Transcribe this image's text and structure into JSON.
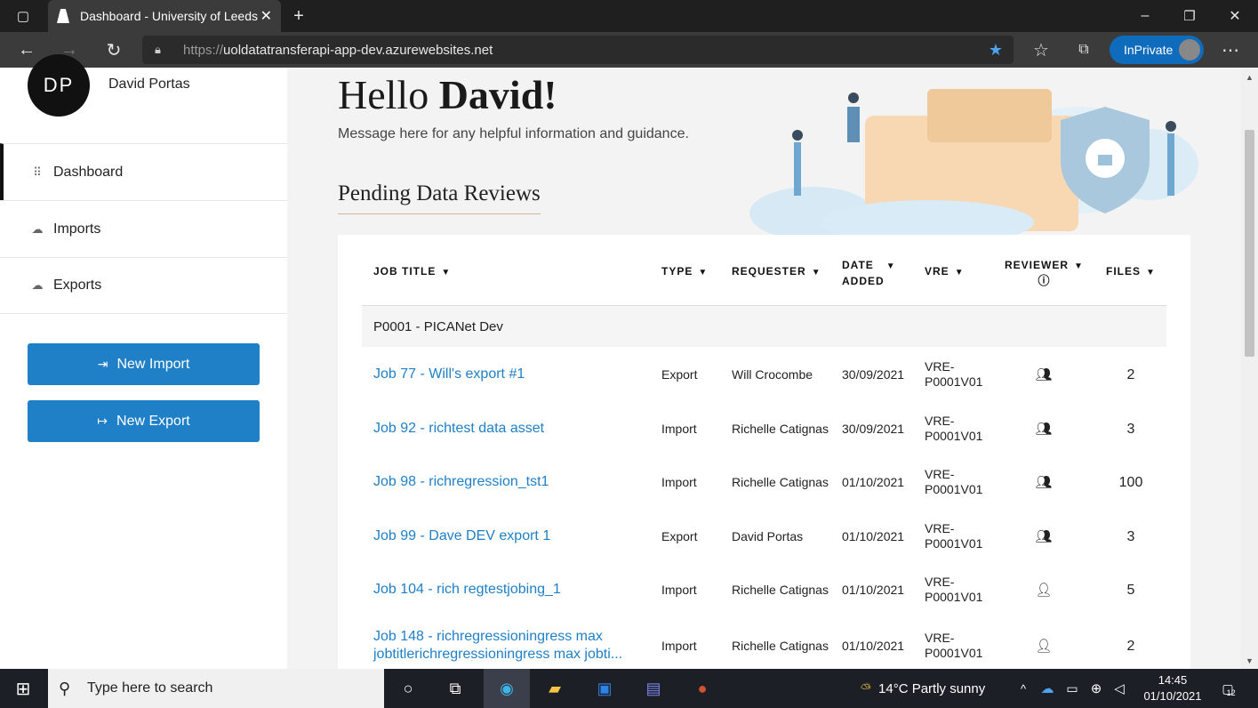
{
  "browser": {
    "tab_title": "Dashboard - University of Leeds",
    "url_protocol": "https://",
    "url_host": "uoldatatransferapi-app-dev.azurewebsites.net",
    "inprivate_label": "InPrivate"
  },
  "user": {
    "initials": "DP",
    "name": "David Portas"
  },
  "sidebar": {
    "items": [
      {
        "label": "Dashboard",
        "icon": "grid-icon",
        "active": true
      },
      {
        "label": "Imports",
        "icon": "cloud-icon"
      },
      {
        "label": "Exports",
        "icon": "cloud-icon"
      }
    ],
    "new_import_label": "New Import",
    "new_export_label": "New Export"
  },
  "main": {
    "hello_prefix": "Hello ",
    "hello_name": "David!",
    "message": "Message here for any helpful information and guidance.",
    "section_title": "Pending Data Reviews"
  },
  "table": {
    "headers": {
      "job_title": "JOB TITLE",
      "type": "TYPE",
      "requester": "REQUESTER",
      "date_added_1": "DATE",
      "date_added_2": "ADDED",
      "vre": "VRE",
      "reviewer": "REVIEWER",
      "files": "FILES"
    },
    "group": "P0001 - PICANet Dev",
    "rows": [
      {
        "title": "Job 77 - Will's export #1",
        "type": "Export",
        "requester": "Will Crocombe",
        "date": "30/09/2021",
        "vre": "VRE-P0001V01",
        "reviewer": "group",
        "files": "2"
      },
      {
        "title": "Job 92 - richtest data asset",
        "type": "Import",
        "requester": "Richelle Catignas",
        "date": "30/09/2021",
        "vre": "VRE-P0001V01",
        "reviewer": "group",
        "files": "3"
      },
      {
        "title": "Job 98 - richregression_tst1",
        "type": "Import",
        "requester": "Richelle Catignas",
        "date": "01/10/2021",
        "vre": "VRE-P0001V01",
        "reviewer": "group",
        "files": "100"
      },
      {
        "title": "Job 99 - Dave DEV export 1",
        "type": "Export",
        "requester": "David Portas",
        "date": "01/10/2021",
        "vre": "VRE-P0001V01",
        "reviewer": "group",
        "files": "3"
      },
      {
        "title": "Job 104 - rich regtestjobing_1",
        "type": "Import",
        "requester": "Richelle Catignas",
        "date": "01/10/2021",
        "vre": "VRE-P0001V01",
        "reviewer": "single",
        "files": "5"
      },
      {
        "title": "Job 148 - richregressioningress max jobtitlerichregressioningress max jobti...",
        "type": "Import",
        "requester": "Richelle Catignas",
        "date": "01/10/2021",
        "vre": "VRE-P0001V01",
        "reviewer": "single",
        "files": "2"
      }
    ]
  },
  "taskbar": {
    "search_placeholder": "Type here to search",
    "temperature": "14°C",
    "weather": "Partly sunny",
    "time": "14:45",
    "date": "01/10/2021",
    "notification_count": "12"
  },
  "colors": {
    "accent": "#1f7fc7",
    "sidebar_button": "#1f7fc7",
    "edge_inprivate": "#0f6cbd"
  }
}
